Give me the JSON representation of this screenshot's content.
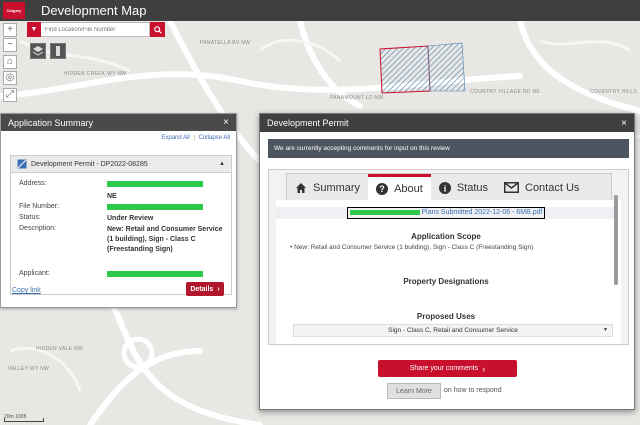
{
  "header": {
    "title": "Development Map",
    "logo_text": "Calgary"
  },
  "search": {
    "placeholder": "Find Location/File Number"
  },
  "map": {
    "streets": [
      {
        "label": "PANATELLA BV NW"
      },
      {
        "label": "HIDDEN CREEK WY NW"
      },
      {
        "label": "PANAMOUNT LD NW"
      },
      {
        "label": "COUNTRY VILLAGE RD NE"
      },
      {
        "label": "COVENTRY HILLS"
      },
      {
        "label": "HIDDEN VALE NW"
      },
      {
        "label": "VALLEY WY NW"
      }
    ],
    "scale_label": "20m 100ft"
  },
  "app_summary": {
    "title": "Application Summary",
    "expand_all": "Expand All",
    "separator": "|",
    "collapse_all": "Collapse All",
    "card_title": "Development Permit - DP2022-08285",
    "fields": {
      "address_label": "Address:",
      "address_suffix": "NE",
      "file_label": "File Number:",
      "status_label": "Status:",
      "status_value": "Under Review",
      "description_label": "Description:",
      "description_value": "New: Retail and Consumer Service (1 building), Sign - Class C (Freestanding Sign)",
      "applicant_label": "Applicant:"
    },
    "copy_link": "Copy link",
    "details": "Details"
  },
  "dev_permit": {
    "title": "Development Permit",
    "banner": "We are currently accepting comments for input on this review",
    "tabs": [
      {
        "label": "Summary",
        "icon": "home-icon"
      },
      {
        "label": "About",
        "icon": "question-icon"
      },
      {
        "label": "Status",
        "icon": "info-icon"
      },
      {
        "label": "Contact Us",
        "icon": "envelope-icon"
      }
    ],
    "plans_link": "Plans Submitted 2022-12-06 - 6MB.pdf",
    "application_scope_title": "Application Scope",
    "application_scope_item": "New: Retail and Consumer Service (1 building), Sign - Class C (Freestanding Sign)",
    "property_designations_title": "Property Designations",
    "proposed_uses_title": "Proposed Uses",
    "proposed_uses_value": "Sign - Class C, Retail and Consumer Service",
    "share_button": "Share your comments",
    "learn_more_button": "Learn More",
    "learn_more_text": "on how to respond"
  },
  "colors": {
    "accent": "#c8102e",
    "header": "#3f3f3f",
    "highlight": "#2ec94a"
  }
}
